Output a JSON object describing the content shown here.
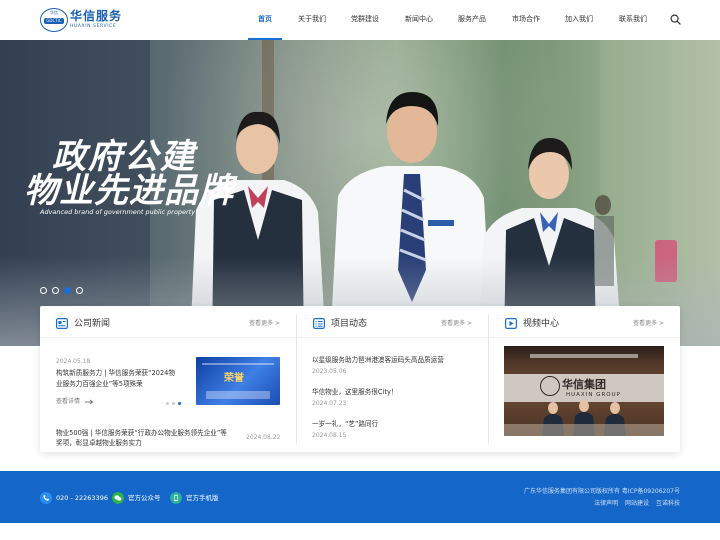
{
  "brand": {
    "name_cn": "华信服务",
    "name_en": "HUAXIN SERVICE",
    "badge_top": "华信",
    "badge_abbr": "GDCTIC",
    "color": "#1a5fb4"
  },
  "nav": {
    "items": [
      "首页",
      "关于我们",
      "党群建设",
      "新闻中心",
      "服务产品",
      "市场合作",
      "加入我们",
      "联系我们"
    ],
    "active_index": 0,
    "accent": "#1a6fd4",
    "search_icon": "search-icon"
  },
  "banner": {
    "slogan_line1": "政府公建",
    "slogan_line2": "物业先进品牌",
    "slogan_en": "Advanced brand of government public property",
    "slides_count": 4,
    "active_slide": 2,
    "wall_text_cn": "华信集团",
    "wall_text_en": "HUAXIN GROUP"
  },
  "news": {
    "title": "公司新闻",
    "more": "查看更多 >",
    "featured": {
      "date": "2024.05.18",
      "title_line1": "构筑新质服务力 | 华信服务荣获“2024物",
      "title_line2": "业服务力百强企业”等5项殊荣",
      "read_more": "查看详情",
      "image_text": "荣誉"
    },
    "item": {
      "title_line1": "物业500强 | 华信服务荣获“行政办公物业服务领先企业”等",
      "title_line2": "奖项，彰显卓越物业服务实力",
      "date": "2024.08.22"
    }
  },
  "projects": {
    "title": "项目动态",
    "more": "查看更多 >",
    "items": [
      {
        "title": "以星级服务助力琶洲港澳客运码头高品质运营",
        "date": "2023.05.06"
      },
      {
        "title": "华信物业，这里服务很City！",
        "date": "2024.07.23"
      },
      {
        "title": "一岁一礼，“艺”路同行",
        "date": "2024.08.15"
      }
    ]
  },
  "video": {
    "title": "视频中心",
    "more": "查看更多 >",
    "wall_text_cn": "华信集团",
    "wall_text_en": "HUAXIN GROUP"
  },
  "footer": {
    "phone": "020 - 22263396",
    "wechat": "官方公众号",
    "mobile": "官方手机版",
    "copyright": "广东华信服务集团有限公司版权所有   粤ICP备09206207号",
    "links": [
      "法律声明",
      "网站建设",
      "互诺科技"
    ]
  }
}
